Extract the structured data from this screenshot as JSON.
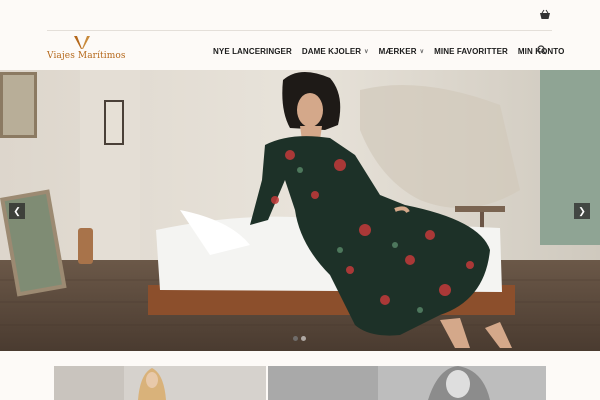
{
  "header": {
    "logo_text": "Viajes Marítimos",
    "nav": [
      {
        "label": "NYE LANCERINGER",
        "has_dropdown": false
      },
      {
        "label": "DAME KJOLER",
        "has_dropdown": true
      },
      {
        "label": "MÆRKER",
        "has_dropdown": true
      },
      {
        "label": "MINE FAVORITTER",
        "has_dropdown": false
      },
      {
        "label": "MIN KONTO",
        "has_dropdown": false
      }
    ],
    "icons": {
      "cart": "shopping-basket-icon",
      "search": "search-icon",
      "dropdown": "chevron-down-icon"
    }
  },
  "hero": {
    "slide_count": 2,
    "active_slide": 1,
    "prev_icon": "chevron-left-icon",
    "next_icon": "chevron-right-icon"
  },
  "colors": {
    "brand": "#b5681b",
    "nav_text": "#1c1c1c",
    "background": "#fdfaf7"
  }
}
